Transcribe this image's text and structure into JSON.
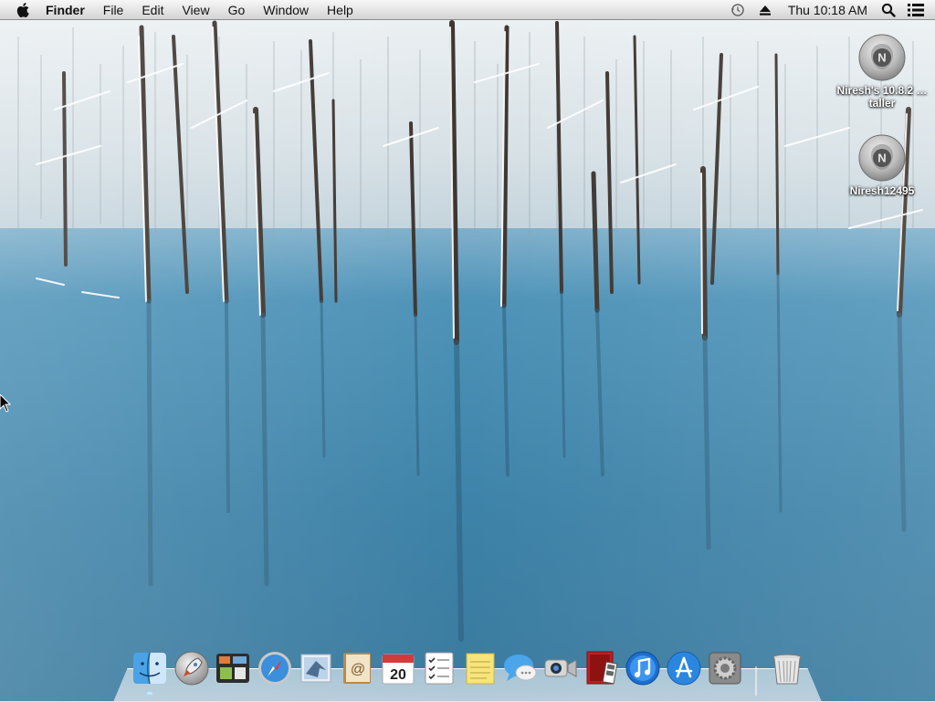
{
  "menubar": {
    "apple_icon": "apple-logo-icon",
    "app_name": "Finder",
    "menus": [
      "File",
      "Edit",
      "View",
      "Go",
      "Window",
      "Help"
    ],
    "status_icons": [
      "time-machine-icon",
      "eject-icon",
      "spotlight-icon",
      "notification-center-icon"
    ],
    "clock": "Thu 10:18 AM"
  },
  "desktop": {
    "icons": [
      {
        "label": "Niresh's 10.8.2 …taller",
        "icon": "installer-disc-icon"
      },
      {
        "label": "Niresh12495",
        "icon": "hard-drive-disc-icon"
      }
    ]
  },
  "dock": {
    "items": [
      {
        "name": "Finder",
        "icon": "finder-icon",
        "running": true
      },
      {
        "name": "Launchpad",
        "icon": "launchpad-icon"
      },
      {
        "name": "Mission Control",
        "icon": "mission-control-icon"
      },
      {
        "name": "Safari",
        "icon": "safari-icon"
      },
      {
        "name": "Mail",
        "icon": "mail-icon"
      },
      {
        "name": "Contacts",
        "icon": "contacts-icon"
      },
      {
        "name": "Calendar",
        "icon": "calendar-icon",
        "text": "20"
      },
      {
        "name": "Reminders",
        "icon": "reminders-icon"
      },
      {
        "name": "Notes",
        "icon": "notes-icon"
      },
      {
        "name": "Messages",
        "icon": "messages-icon"
      },
      {
        "name": "FaceTime",
        "icon": "facetime-icon"
      },
      {
        "name": "Photo Booth",
        "icon": "photo-booth-icon"
      },
      {
        "name": "iTunes",
        "icon": "itunes-icon"
      },
      {
        "name": "App Store",
        "icon": "app-store-icon"
      },
      {
        "name": "System Preferences",
        "icon": "system-preferences-icon"
      },
      {
        "name": "Trash",
        "icon": "trash-icon"
      }
    ]
  }
}
